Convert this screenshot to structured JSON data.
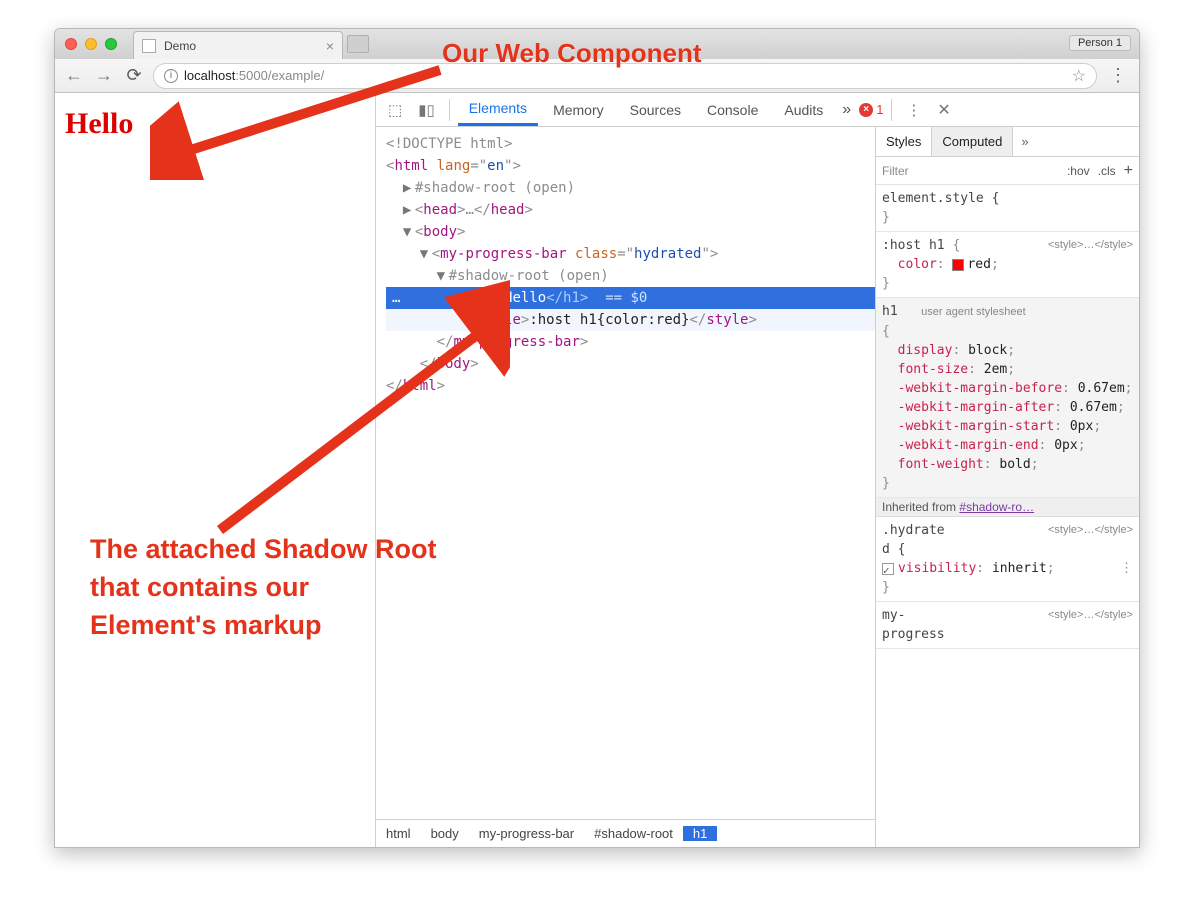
{
  "browser": {
    "tab_title": "Demo",
    "person_label": "Person 1",
    "url_host": "localhost",
    "url_path": ":5000/example/"
  },
  "page": {
    "heading": "Hello"
  },
  "devtools": {
    "tabs": [
      "Elements",
      "Memory",
      "Sources",
      "Console",
      "Audits"
    ],
    "active_tab": "Elements",
    "error_count": "1",
    "breadcrumb": [
      "html",
      "body",
      "my-progress-bar",
      "#shadow-root",
      "h1"
    ],
    "dom": {
      "doctype": "<!DOCTYPE html>",
      "html_lang": "en",
      "shadow1": "#shadow-root (open)",
      "head_ellipsis": "…",
      "mpb_tag": "my-progress-bar",
      "mpb_class": "hydrated",
      "shadow2": "#shadow-root (open)",
      "h1_text": "Hello",
      "sel_annot": "== $0",
      "style_text": ":host h1{color:red}"
    },
    "styles": {
      "tabs": [
        "Styles",
        "Computed"
      ],
      "filter_placeholder": "Filter",
      "hov": ":hov",
      "cls": ".cls",
      "rule_element_style": "element.style {",
      "rule_host_sel": ":host h1",
      "rule_host_src": "<style>…</style>",
      "rule_host_prop": "color",
      "rule_host_val": "red",
      "rule_h1_sel": "h1",
      "rule_h1_ua": "user agent stylesheet",
      "h1_props": [
        {
          "p": "display",
          "v": "block"
        },
        {
          "p": "font-size",
          "v": "2em"
        },
        {
          "p": "-webkit-margin-before",
          "v": "0.67em"
        },
        {
          "p": "-webkit-margin-after",
          "v": "0.67em"
        },
        {
          "p": "-webkit-margin-start",
          "v": "0px"
        },
        {
          "p": "-webkit-margin-end",
          "v": "0px"
        },
        {
          "p": "font-weight",
          "v": "bold"
        }
      ],
      "inherited_from": "Inherited from",
      "inherited_link": "#shadow-ro…",
      "hydrated_sel": ".hydrated",
      "hydrated_sel_broken_a": ".hydrate",
      "hydrated_sel_broken_b": "d {",
      "hydrated_src": "<style>…</style>",
      "hydrated_prop": "visibility",
      "hydrated_val": "inherit",
      "myprog_sel_a": "my-",
      "myprog_sel_b": "progress",
      "myprog_src": "<style>…</style>"
    }
  },
  "annotations": {
    "title": "Our Web Component",
    "body_l1": "The attached Shadow Root",
    "body_l2": "that contains our",
    "body_l3": "Element's markup"
  }
}
